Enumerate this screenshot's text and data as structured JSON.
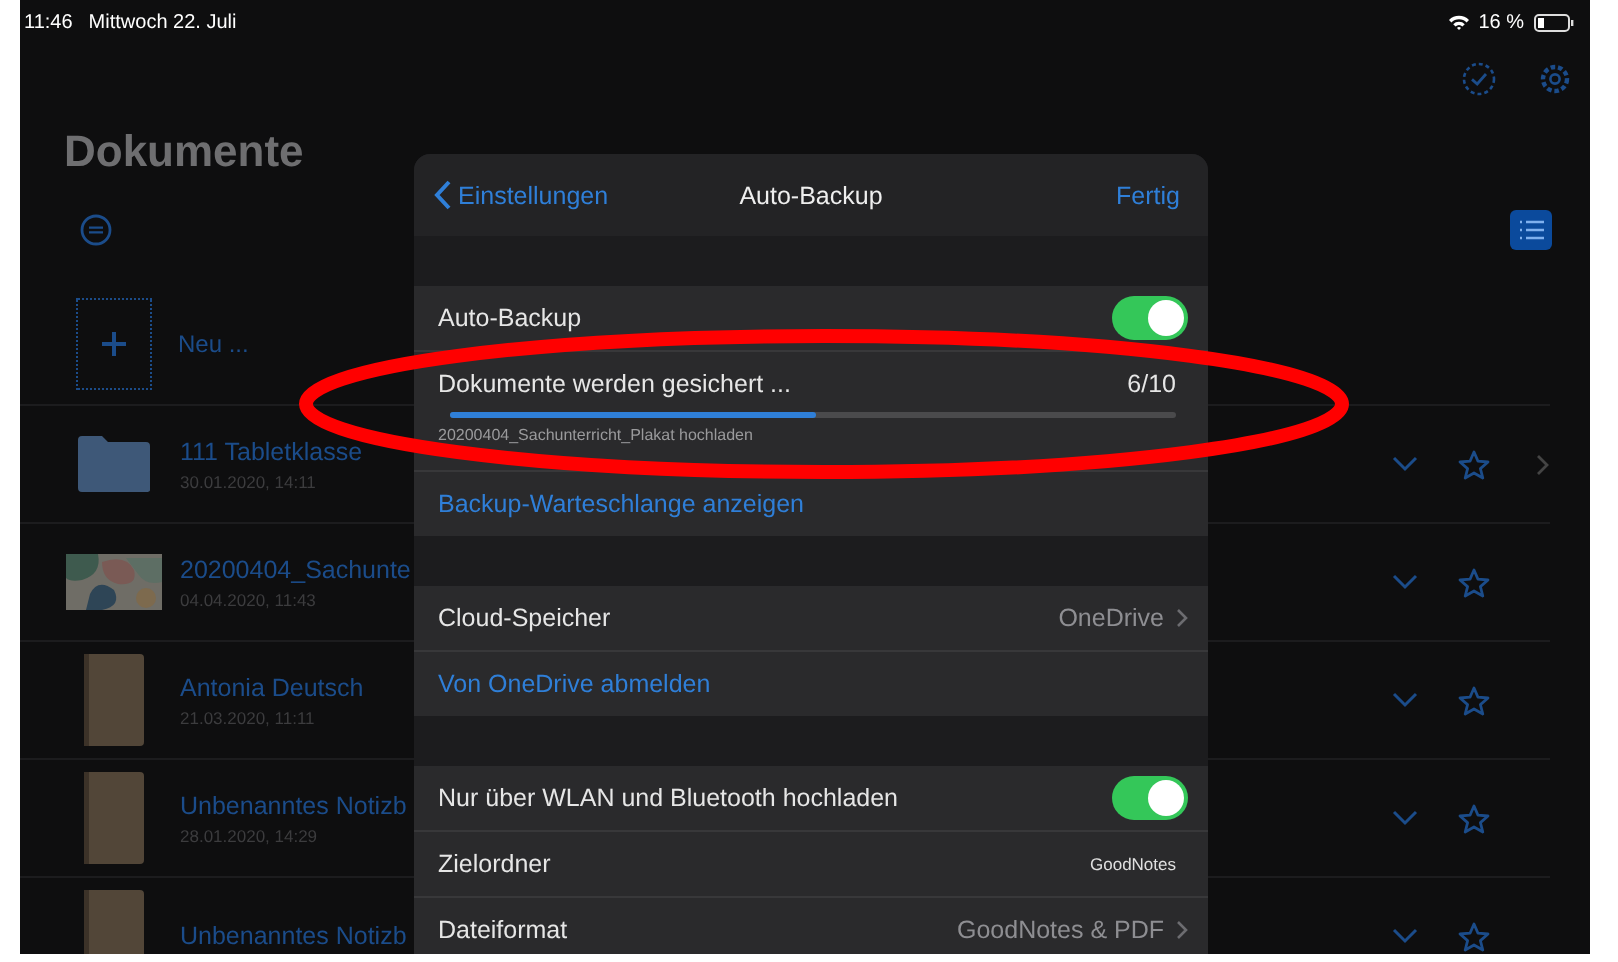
{
  "status_bar": {
    "time": "11:46",
    "date": "Mittwoch 22. Juli",
    "battery": "16 %"
  },
  "documents": {
    "title": "Dokumente",
    "new_label": "Neu ...",
    "items": [
      {
        "kind": "folder",
        "name": "111 Tabletklasse",
        "date": "30.01.2020, 14:11"
      },
      {
        "kind": "picture",
        "name": "20200404_Sachunte",
        "date": "04.04.2020, 11:43"
      },
      {
        "kind": "notebook",
        "name": "Antonia Deutsch",
        "date": "21.03.2020, 11:11"
      },
      {
        "kind": "notebook",
        "name": "Unbenanntes Notizb",
        "date": "28.01.2020, 14:29"
      },
      {
        "kind": "notebook",
        "name": "Unbenanntes Notizb"
      }
    ]
  },
  "settings_popover": {
    "back_label": "Einstellungen",
    "title": "Auto-Backup",
    "done_label": "Fertig",
    "sections": [
      [
        {
          "kind": "toggle",
          "label": "Auto-Backup",
          "on": true
        },
        {
          "kind": "progress",
          "label": "Dokumente werden gesichert ...",
          "count": "6/10",
          "level": 0.505,
          "detail": "20200404_Sachunterricht_Plakat hochladen"
        },
        {
          "kind": "link",
          "label": "Backup-Warteschlange anzeigen"
        }
      ],
      [
        {
          "kind": "value",
          "label": "Cloud-Speicher",
          "value": "OneDrive",
          "disclosure": true
        },
        {
          "kind": "link",
          "label": "Von OneDrive abmelden"
        }
      ],
      [
        {
          "kind": "toggle",
          "label": "Nur über WLAN und Bluetooth hochladen",
          "on": true
        },
        {
          "kind": "value",
          "label": "Zielordner",
          "value": "GoodNotes",
          "disclosure": false
        },
        {
          "kind": "value",
          "label": "Dateiformat",
          "value": "GoodNotes & PDF",
          "disclosure": true
        }
      ]
    ]
  },
  "annotations": [
    {
      "kind": "ellipse"
    }
  ]
}
